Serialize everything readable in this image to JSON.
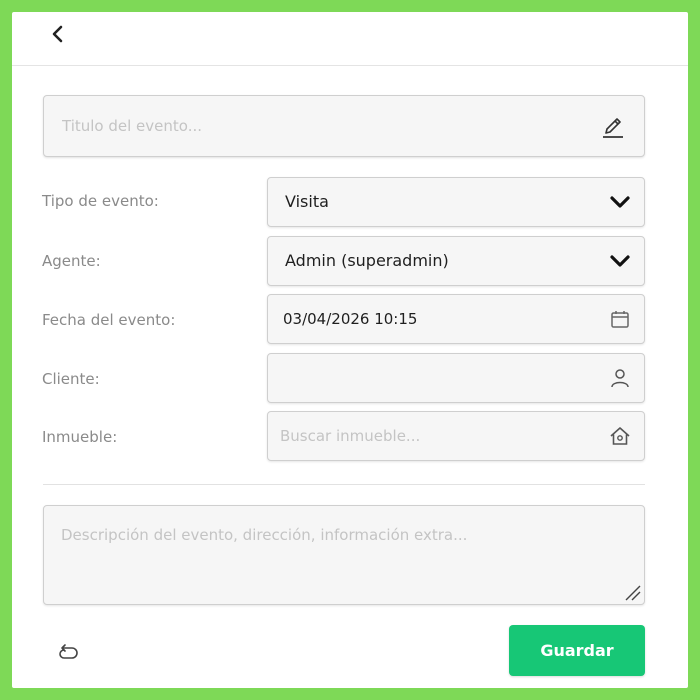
{
  "header": {
    "back_icon": "chevron-left-icon"
  },
  "form": {
    "title_placeholder": "Titulo del evento...",
    "tipo": {
      "label": "Tipo de evento:",
      "value": "Visita"
    },
    "agente": {
      "label": "Agente:",
      "value": "Admin (superadmin)"
    },
    "fecha": {
      "label": "Fecha del evento:",
      "value": "03/04/2026 10:15"
    },
    "cliente": {
      "label": "Cliente:",
      "value": ""
    },
    "inmueble": {
      "label": "Inmueble:",
      "placeholder": "Buscar inmueble..."
    },
    "description_placeholder": "Descripción del evento, dirección, información extra..."
  },
  "actions": {
    "save_label": "Guardar",
    "reset_icon": "reset-icon"
  },
  "colors": {
    "frame": "#7ed957",
    "save_button": "#17c776"
  }
}
